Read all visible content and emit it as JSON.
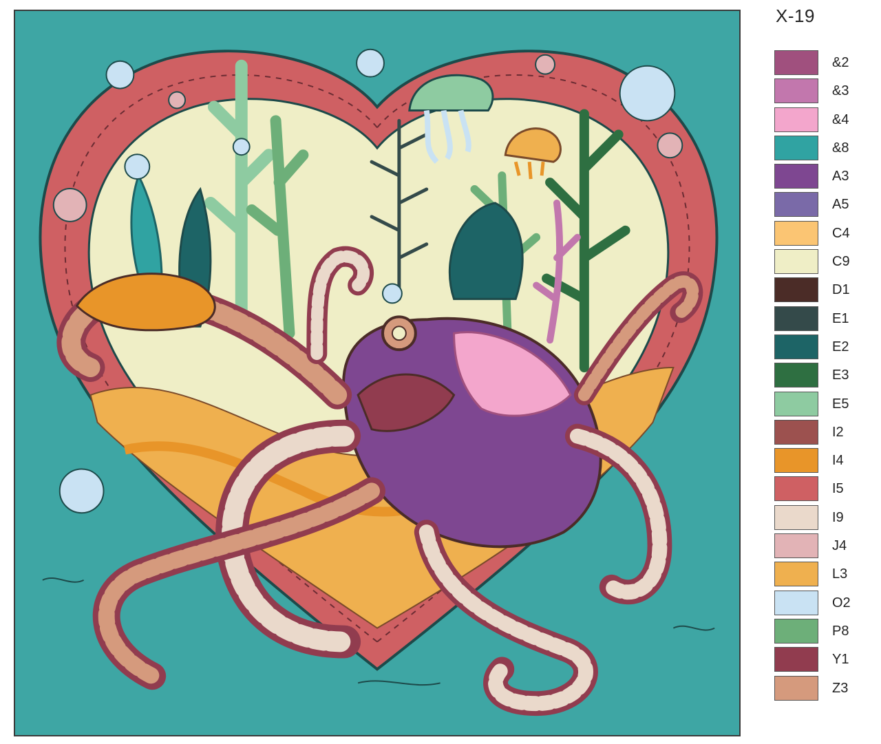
{
  "kit_code": "X-19",
  "palette": [
    {
      "code": "&2",
      "color": "#a0507e"
    },
    {
      "code": "&3",
      "color": "#c277ad"
    },
    {
      "code": "&4",
      "color": "#f3a6cc"
    },
    {
      "code": "&8",
      "color": "#30a3a2"
    },
    {
      "code": "A3",
      "color": "#7e4791"
    },
    {
      "code": "A5",
      "color": "#7a6aa8"
    },
    {
      "code": "C4",
      "color": "#fbc573"
    },
    {
      "code": "C9",
      "color": "#efeec6"
    },
    {
      "code": "D1",
      "color": "#4b2c27"
    },
    {
      "code": "E1",
      "color": "#344a4a"
    },
    {
      "code": "E2",
      "color": "#1d6466"
    },
    {
      "code": "E3",
      "color": "#2e6f41"
    },
    {
      "code": "E5",
      "color": "#8ecba1"
    },
    {
      "code": "I2",
      "color": "#9c514f"
    },
    {
      "code": "I4",
      "color": "#e89529"
    },
    {
      "code": "I5",
      "color": "#cf6063"
    },
    {
      "code": "I9",
      "color": "#ead9cb"
    },
    {
      "code": "J4",
      "color": "#e2b3b6"
    },
    {
      "code": "L3",
      "color": "#efb04f"
    },
    {
      "code": "O2",
      "color": "#c9e2f3"
    },
    {
      "code": "P8",
      "color": "#6daf79"
    },
    {
      "code": "Y1",
      "color": "#913c4f"
    },
    {
      "code": "Z3",
      "color": "#d59a7d"
    }
  ]
}
